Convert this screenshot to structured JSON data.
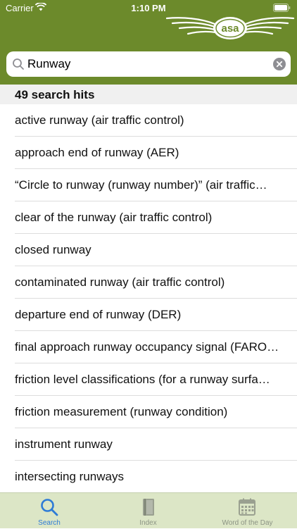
{
  "status_bar": {
    "carrier": "Carrier",
    "time": "1:10 PM"
  },
  "header": {
    "logo_text": "asa",
    "background_color": "#6c8a2b"
  },
  "search": {
    "value": "Runway",
    "placeholder": ""
  },
  "results": {
    "header": "49 search hits",
    "items": [
      "active runway (air traffic control)",
      "approach end of runway (AER)",
      "“Circle to runway (runway number)” (air traffic…",
      "clear of the runway (air traffic control)",
      "closed runway",
      "contaminated runway (air traffic control)",
      "departure end of runway (DER)",
      "final approach runway occupancy signal (FARO…",
      "friction level classifications (for a runway surfa…",
      "friction measurement (runway condition)",
      "instrument runway",
      "intersecting runways"
    ]
  },
  "tabs": [
    {
      "label": "Search",
      "icon": "search-icon",
      "active": true
    },
    {
      "label": "Index",
      "icon": "book-icon",
      "active": false
    },
    {
      "label": "Word of the Day",
      "icon": "calendar-icon",
      "active": false
    }
  ],
  "colors": {
    "accent": "#2e7bd6",
    "tab_bar": "#dce6c6"
  }
}
